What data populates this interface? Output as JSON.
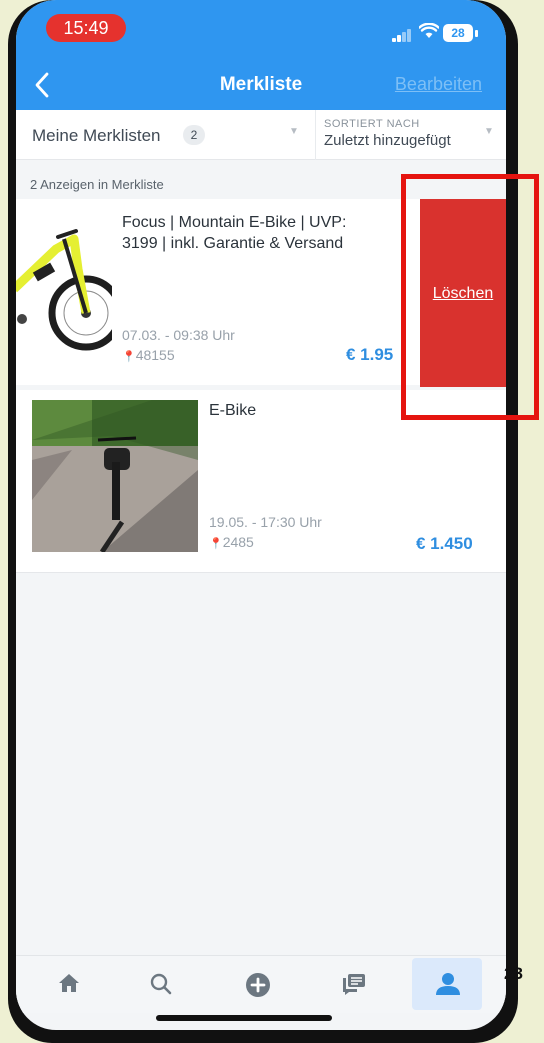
{
  "status_bar": {
    "time": "15:49",
    "battery": "28"
  },
  "header": {
    "title": "Merkliste",
    "edit_label": "Bearbeiten"
  },
  "filter": {
    "lists_label": "Meine Merklisten",
    "lists_count": "2",
    "sort_label": "SORTIERT NACH",
    "sort_value": "Zuletzt hinzugefügt"
  },
  "count_text": "2 Anzeigen in Merkliste",
  "listings": [
    {
      "title": "Focus | Mountain E-Bike | UVP: 3199 | inkl. Garantie & Versand",
      "date": "07.03. - 09:38 Uhr",
      "location": "48155",
      "price": "€ 1.95"
    },
    {
      "title": "E-Bike",
      "date": "19.05. - 17:30 Uhr",
      "location": "2485",
      "price": "€ 1.450"
    }
  ],
  "delete_label": "Löschen",
  "tabs": [
    {
      "name": "home-icon",
      "active": false
    },
    {
      "name": "search-icon",
      "active": false
    },
    {
      "name": "plus-icon",
      "active": false
    },
    {
      "name": "messages-icon",
      "active": false
    },
    {
      "name": "user-icon",
      "active": true
    }
  ],
  "overlay_text": "23",
  "colors": {
    "accent": "#2f96f0",
    "delete": "#d9322e",
    "highlight": "#e5140f",
    "price": "#2f8ee0"
  }
}
